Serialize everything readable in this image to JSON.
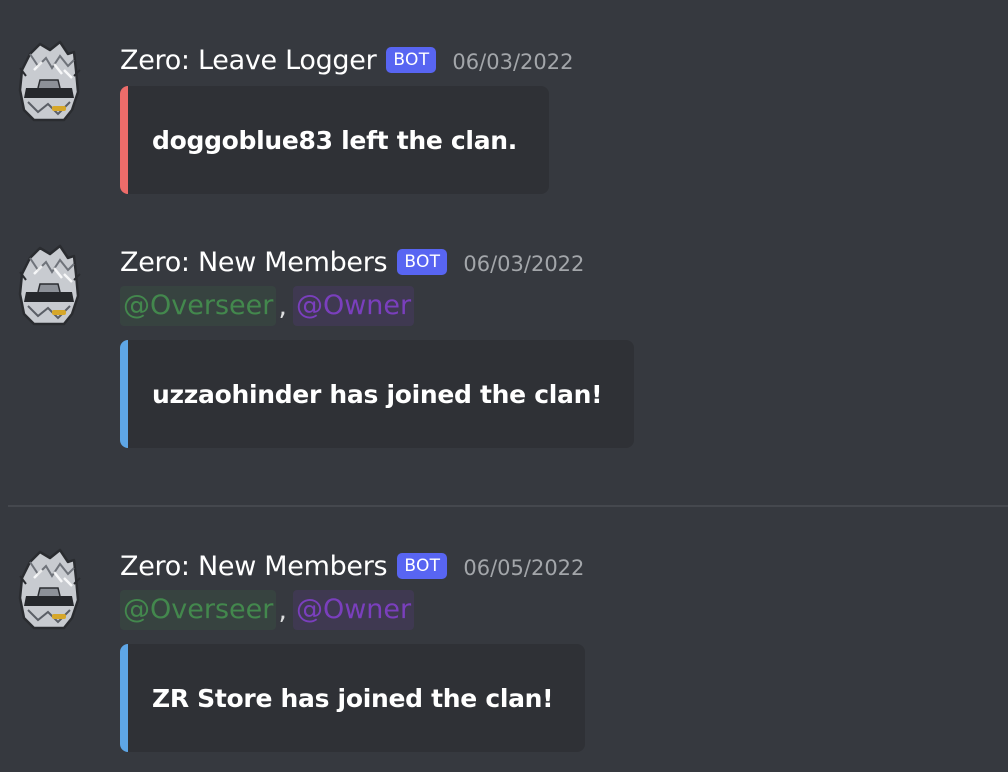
{
  "messages": [
    {
      "username": "Zero: Leave Logger",
      "bot_tag": "BOT",
      "timestamp": "06/03/2022",
      "embed_text": "doggoblue83 left the clan.",
      "embed_color": "#ed6c6a"
    },
    {
      "username": "Zero: New Members",
      "bot_tag": "BOT",
      "timestamp": "06/03/2022",
      "mentions": [
        "@Overseer",
        "@Owner"
      ],
      "separator": ",",
      "embed_text": "uzzaohinder has joined the clan!",
      "embed_color": "#5ea6e6"
    },
    {
      "username": "Zero: New Members",
      "bot_tag": "BOT",
      "timestamp": "06/05/2022",
      "mentions": [
        "@Overseer",
        "@Owner"
      ],
      "separator": ",",
      "embed_text": "ZR Store has joined the clan!",
      "embed_color": "#5ea6e6"
    }
  ],
  "colors": {
    "background": "#36393f",
    "embed_background": "#2f3136",
    "bot_tag": "#5865f2",
    "mention_overseer": "#43884d",
    "mention_owner": "#7a3fbd"
  },
  "icons": {
    "avatar": "armored-knight-helmet-avatar"
  }
}
